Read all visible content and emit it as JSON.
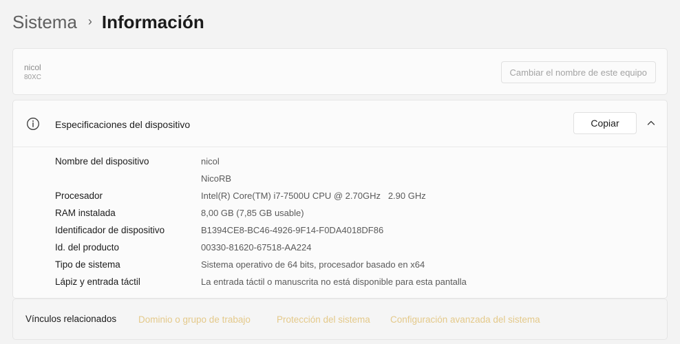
{
  "breadcrumb": {
    "parent": "Sistema",
    "separator": "›",
    "current": "Información"
  },
  "device": {
    "name": "nicol",
    "model": "80XC",
    "rename_button": "Cambiar el nombre de este equipo"
  },
  "specs": {
    "icon": "info-icon",
    "title": "Especificaciones del dispositivo",
    "copy_button": "Copiar",
    "collapse_icon": "chevron-up-icon",
    "rows": [
      {
        "label": "Nombre del dispositivo",
        "value": "nicol"
      },
      {
        "label": "",
        "value": "NicoRB"
      },
      {
        "label": "Procesador",
        "value": "Intel(R) Core(TM) i7-7500U CPU @ 2.70GHz   2.90 GHz"
      },
      {
        "label": "RAM instalada",
        "value": "8,00 GB (7,85 GB usable)"
      },
      {
        "label": "Identificador de dispositivo",
        "value": "B1394CE8-BC46-4926-9F14-F0DA4018DF86"
      },
      {
        "label": "Id. del producto",
        "value": "00330-81620-67518-AA224"
      },
      {
        "label": "Tipo de sistema",
        "value": "Sistema operativo de 64 bits, procesador basado en x64"
      },
      {
        "label": "Lápiz y entrada táctil",
        "value": "La entrada táctil o manuscrita no está disponible para esta pantalla"
      }
    ]
  },
  "related": {
    "label": "Vínculos relacionados",
    "links": [
      "Dominio o grupo de trabajo",
      "Protección del sistema",
      "Configuración avanzada del sistema"
    ],
    "link_color": "#e4c98a"
  }
}
